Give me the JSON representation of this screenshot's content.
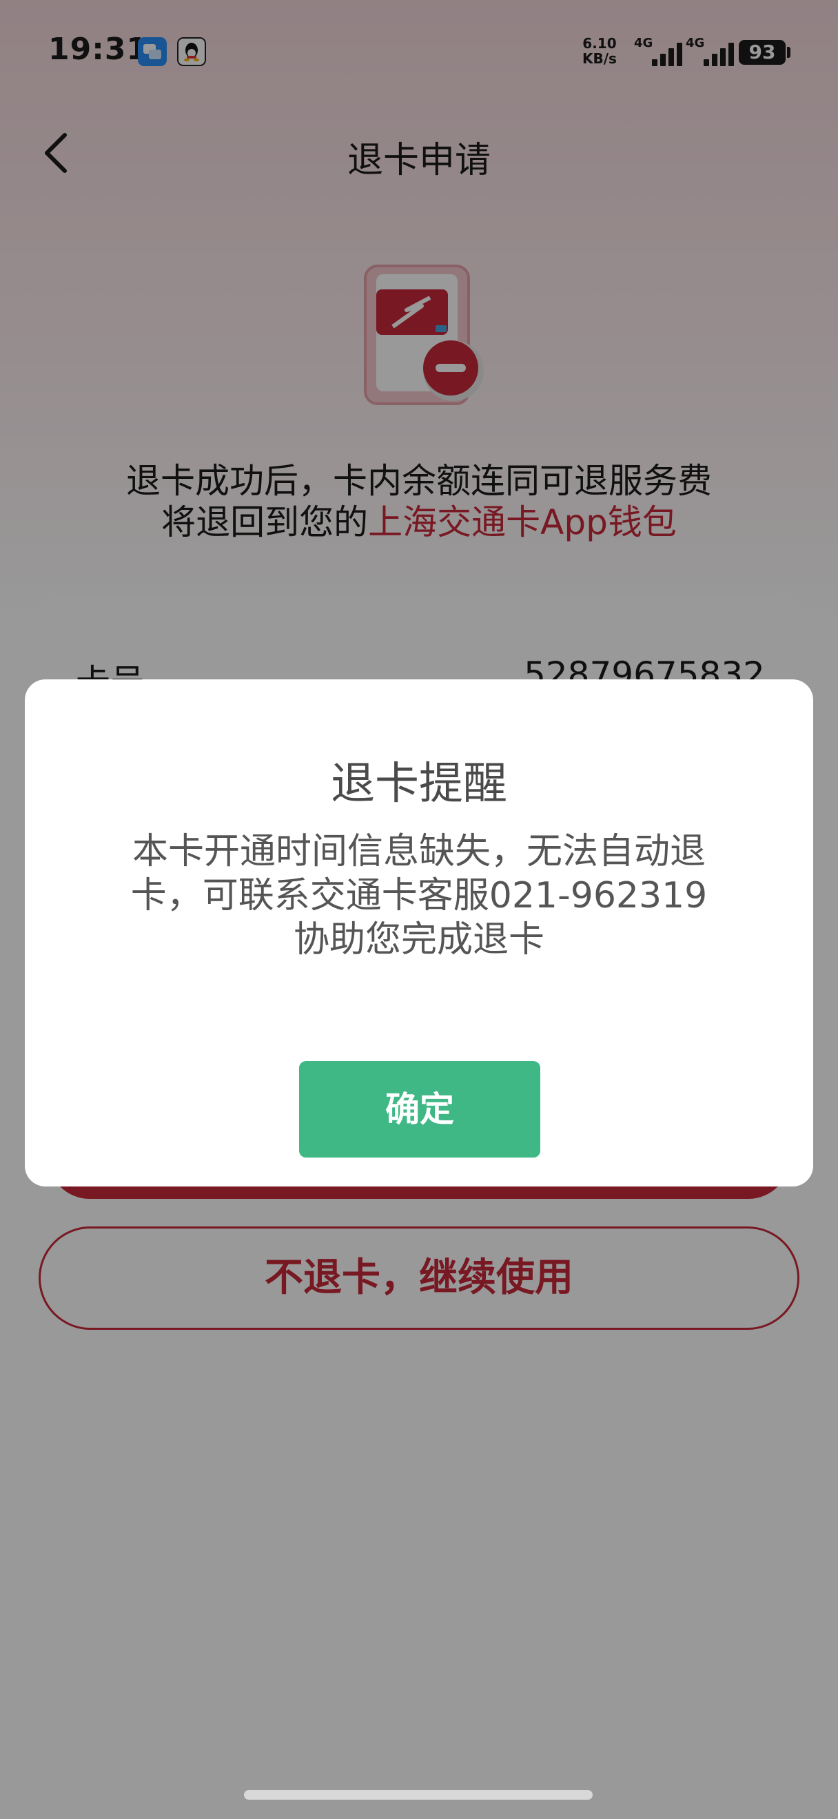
{
  "status_bar": {
    "time": "19:31",
    "net_speed_value": "6.10",
    "net_speed_unit": "KB/s",
    "sim1_label": "4G",
    "sim2_label": "4G",
    "battery": "93"
  },
  "header": {
    "title": "退卡申请"
  },
  "hero": {
    "line1": "退卡成功后，卡内余额连同可退服务费",
    "line2_prefix": "将退回到您的",
    "line2_highlight": "上海交通卡App钱包"
  },
  "card_info": {
    "number_label": "卡号",
    "number_value": "52879675832"
  },
  "actions": {
    "keep_label": "不退卡，继续使用"
  },
  "dialog": {
    "title": "退卡提醒",
    "message_line1": "本卡开通时间信息缺失，无法自动退",
    "message_line2": "卡，可联系交通卡客服021-962319",
    "message_line3": "协助您完成退卡",
    "confirm_label": "确定"
  },
  "colors": {
    "brand_red": "#c8283a",
    "confirm_green": "#3fb886"
  }
}
